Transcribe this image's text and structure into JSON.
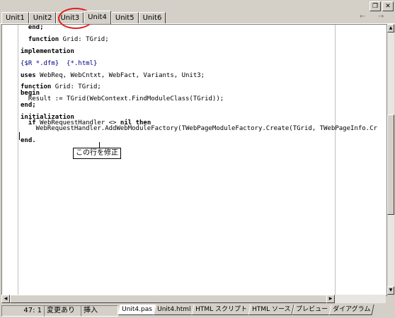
{
  "window": {
    "controls": {
      "restore": "❐",
      "close": "✕"
    }
  },
  "tabs": [
    {
      "label": "Unit1"
    },
    {
      "label": "Unit2"
    },
    {
      "label": "Unit3"
    },
    {
      "label": "Unit4",
      "active": true
    },
    {
      "label": "Unit5"
    },
    {
      "label": "Unit6"
    }
  ],
  "nav": {
    "back": "←",
    "forward": "→"
  },
  "code": [
    [
      {
        "t": "  end;",
        "k": "kw"
      }
    ],
    [
      {
        "t": ""
      }
    ],
    [
      {
        "t": "  "
      },
      {
        "t": "function",
        "k": "kw"
      },
      {
        "t": " Grid: TGrid;"
      }
    ],
    [
      {
        "t": ""
      }
    ],
    [
      {
        "t": "implementation",
        "k": "kw"
      }
    ],
    [
      {
        "t": ""
      }
    ],
    [
      {
        "t": "{$R *.dfm}  {*.html}",
        "k": "dir"
      }
    ],
    [
      {
        "t": ""
      }
    ],
    [
      {
        "t": "uses",
        "k": "kw"
      },
      {
        "t": " WebReq, WebCntxt, WebFact, Variants, Unit3;"
      }
    ],
    [
      {
        "t": ""
      }
    ],
    [
      {
        "t": "function",
        "k": "kw"
      },
      {
        "t": " Grid: TGrid;"
      }
    ],
    [
      {
        "t": "begin",
        "k": "kw"
      }
    ],
    [
      {
        "t": "  Result := TGrid(WebContext.FindModuleClass(TGrid));"
      }
    ],
    [
      {
        "t": "end;",
        "k": "kw"
      }
    ],
    [
      {
        "t": ""
      }
    ],
    [
      {
        "t": "initialization",
        "k": "kw"
      }
    ],
    [
      {
        "t": "  "
      },
      {
        "t": "if",
        "k": "kw"
      },
      {
        "t": " WebRequestHandler <> "
      },
      {
        "t": "nil",
        "k": "kw"
      },
      {
        "t": " "
      },
      {
        "t": "then",
        "k": "kw"
      }
    ],
    [
      {
        "t": "    WebRequestHandler.AddWebModuleFactory(TWebPageModuleFactory.Create(TGrid, TWebPageInfo.Cr"
      }
    ],
    [
      {
        "t": ""
      }
    ],
    [
      {
        "t": "end.",
        "k": "kw"
      }
    ]
  ],
  "callout": {
    "text": "この行を修正"
  },
  "status": {
    "position": "47:  1",
    "modified": "変更あり",
    "mode": "挿入"
  },
  "bottom_tabs": [
    {
      "label": "Unit4.pas",
      "active": true
    },
    {
      "label": "Unit4.html"
    },
    {
      "label": "HTML スクリプト"
    },
    {
      "label": "HTML ソース"
    },
    {
      "label": "プレビュー"
    },
    {
      "label": "ダイアグラム"
    }
  ]
}
